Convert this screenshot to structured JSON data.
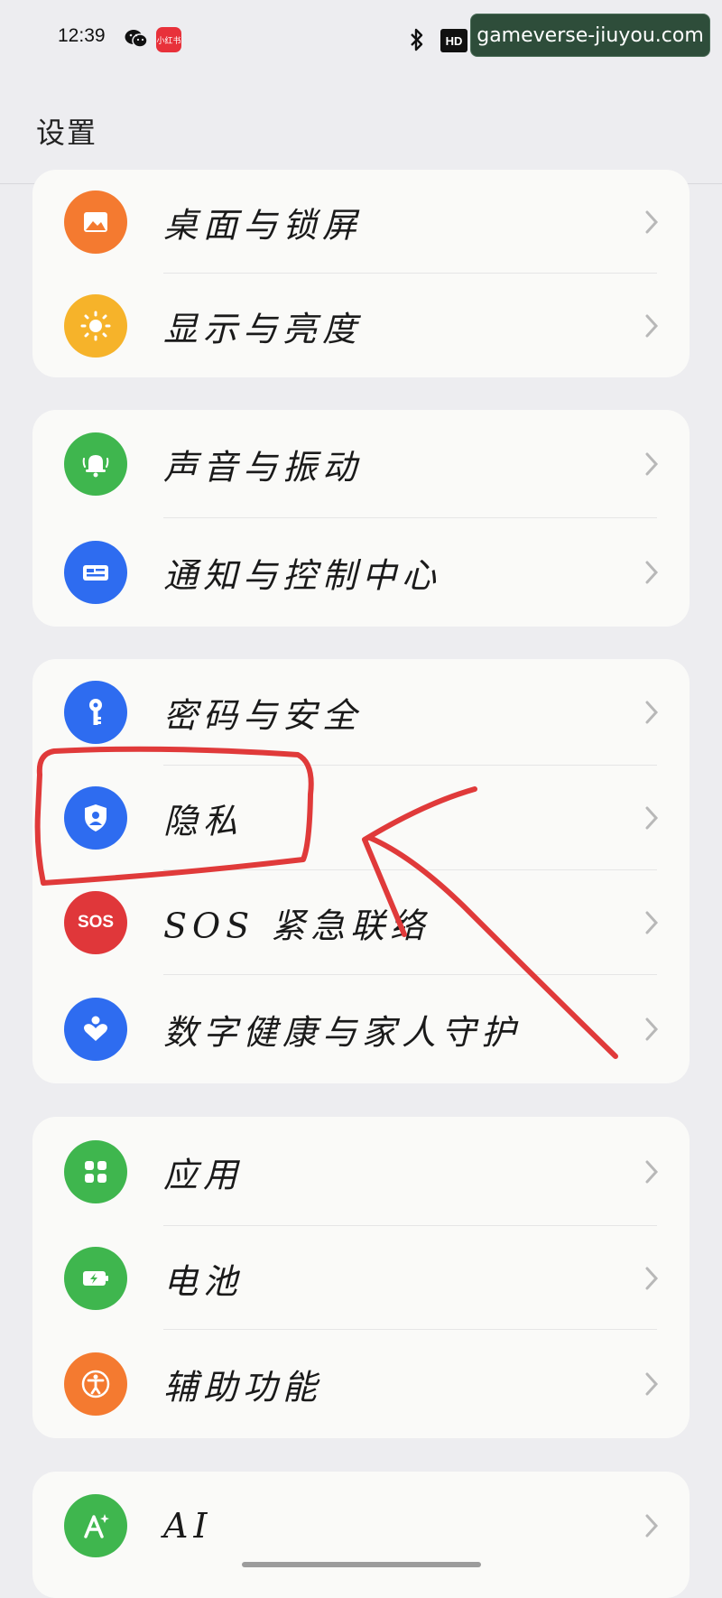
{
  "status_bar": {
    "time": "12:39",
    "xhs_label": "小红书",
    "hd_label": "HD"
  },
  "watermark": "gameverse-jiuyou.com",
  "page_title": "设置",
  "groups": [
    {
      "rows": [
        {
          "label": "桌面与锁屏",
          "icon": "wallpaper-icon",
          "color": "#f47a30"
        },
        {
          "label": "显示与亮度",
          "icon": "brightness-icon",
          "color": "#f6b32a"
        }
      ]
    },
    {
      "rows": [
        {
          "label": "声音与振动",
          "icon": "bell-icon",
          "color": "#3fb64e"
        },
        {
          "label": "通知与控制中心",
          "icon": "notification-center-icon",
          "color": "#2e6cf0"
        }
      ]
    },
    {
      "rows": [
        {
          "label": "密码与安全",
          "icon": "key-icon",
          "color": "#2e6cf0"
        },
        {
          "label": "隐私",
          "icon": "privacy-shield-icon",
          "color": "#2e6cf0"
        },
        {
          "label": "SOS 紧急联络",
          "icon": "sos-icon",
          "color": "#e0373a"
        },
        {
          "label": "数字健康与家人守护",
          "icon": "heart-person-icon",
          "color": "#2e6cf0"
        }
      ]
    },
    {
      "rows": [
        {
          "label": "应用",
          "icon": "apps-grid-icon",
          "color": "#3fb64e"
        },
        {
          "label": "电池",
          "icon": "battery-icon",
          "color": "#3fb64e"
        },
        {
          "label": "辅助功能",
          "icon": "accessibility-icon",
          "color": "#f47a30"
        }
      ]
    },
    {
      "rows": [
        {
          "label": "AI",
          "icon": "ai-sparkle-icon",
          "color": "#3fb64e"
        }
      ]
    }
  ],
  "sos_icon_text": "SOS"
}
